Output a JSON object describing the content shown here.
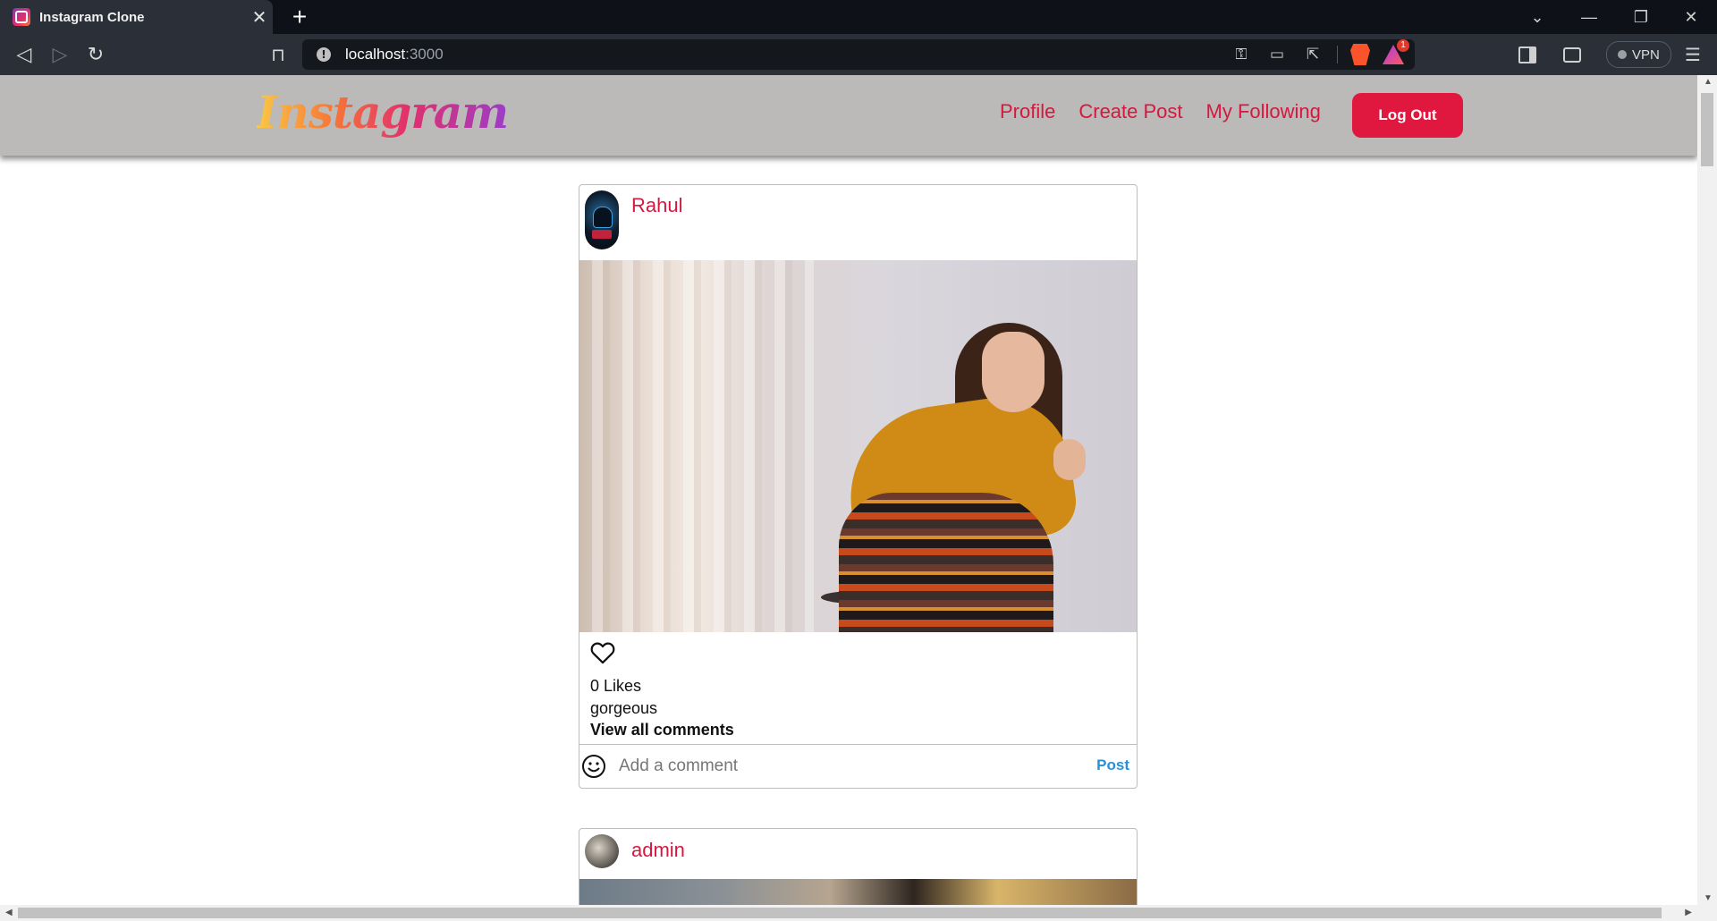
{
  "browser": {
    "tab_title": "Instagram Clone",
    "new_tab_symbol": "+",
    "url_host": "localhost",
    "url_port": ":3000",
    "vpn_label": "VPN",
    "rewards_badge": "1"
  },
  "app": {
    "logo_text": "Instagram",
    "nav": {
      "profile": "Profile",
      "create_post": "Create Post",
      "my_following": "My Following",
      "logout": "Log Out"
    }
  },
  "posts": [
    {
      "username": "Rahul",
      "likes": "0 Likes",
      "caption": "gorgeous",
      "view_comments": "View all comments",
      "comment_placeholder": "Add a comment",
      "post_button": "Post"
    },
    {
      "username": "admin"
    }
  ],
  "colors": {
    "accent": "#e0173f",
    "link": "#d4183f",
    "navbar_bg": "#bbbab8",
    "post_button": "#2b8fd6"
  }
}
